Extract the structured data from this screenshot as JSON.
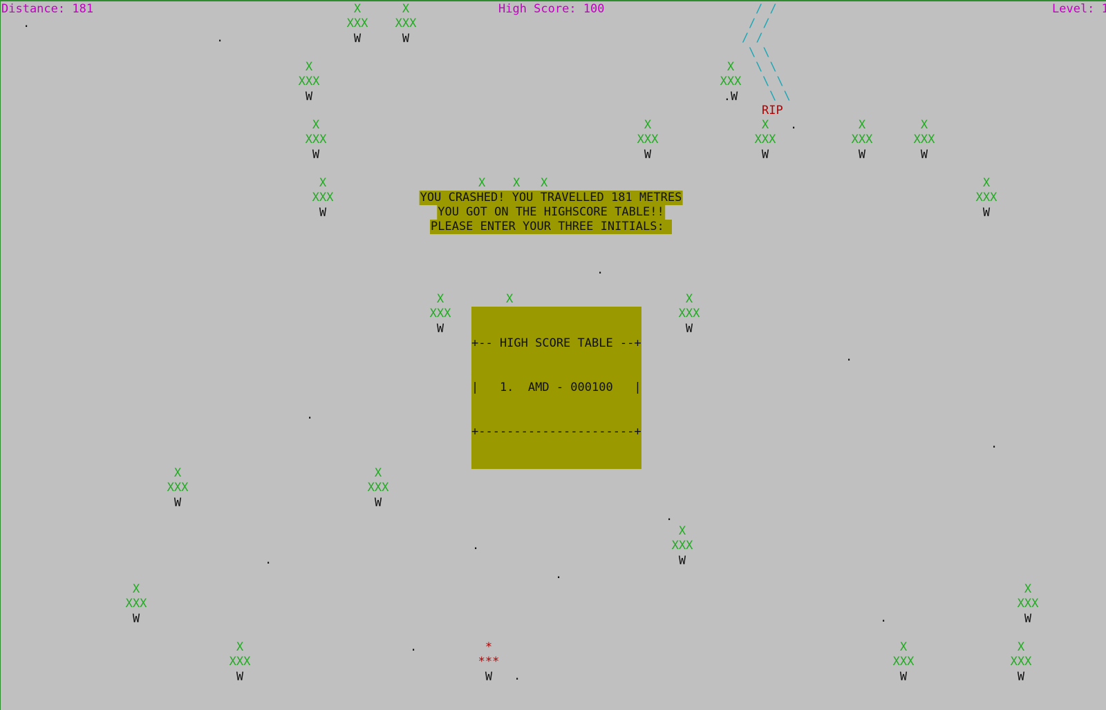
{
  "hud": {
    "distance": "Distance: 181",
    "high_score": "High Score: 100",
    "level": "Level: 1"
  },
  "tree_glyphs": {
    "top": "X",
    "middle": "XXX",
    "trunk": "W"
  },
  "crashed_tree_glyphs": {
    "top": "*",
    "middle": "***",
    "trunk": "W"
  },
  "tracks": {
    "lines": [
      "/ /",
      "/ /",
      "/ /",
      "\\ \\",
      "\\ \\",
      "\\ \\",
      "\\ \\"
    ],
    "rip": "RIP"
  },
  "message": {
    "line1": "YOU CRASHED! YOU TRAVELLED 181 METRES",
    "line2": "YOU GOT ON THE HIGHSCORE TABLE!!",
    "line3": "PLEASE ENTER YOUR THREE INITIALS: "
  },
  "high_score_table": {
    "top": "+-- HIGH SCORE TABLE --+",
    "row": "|   1.  AMD - 000100   |",
    "bottom": "+----------------------+"
  },
  "snow_dot": ".",
  "tree_with_dot_trunk": ".W",
  "colors": {
    "background": "#c0c0c0",
    "hud": "#c000c0",
    "tree": "#22aa22",
    "trunk": "#111111",
    "crash": "#b00000",
    "tracks": "#1aa6b5",
    "dialog": "#9a9a00"
  }
}
